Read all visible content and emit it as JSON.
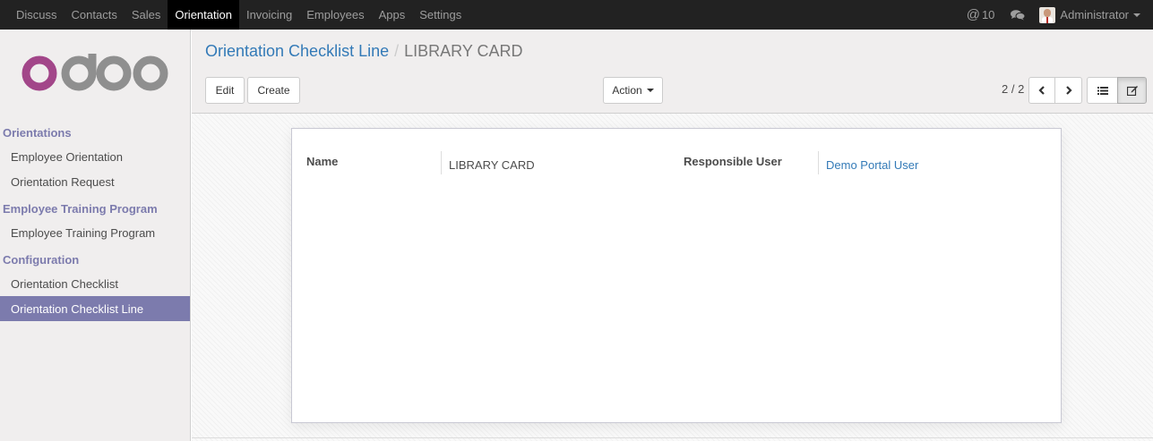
{
  "topbar": {
    "menu": [
      {
        "label": "Discuss",
        "active": false
      },
      {
        "label": "Contacts",
        "active": false
      },
      {
        "label": "Sales",
        "active": false
      },
      {
        "label": "Orientation",
        "active": true
      },
      {
        "label": "Invoicing",
        "active": false
      },
      {
        "label": "Employees",
        "active": false
      },
      {
        "label": "Apps",
        "active": false
      },
      {
        "label": "Settings",
        "active": false
      }
    ],
    "mentions_symbol": "@",
    "mentions_count": "10",
    "chat_icon": "comments-icon",
    "user_name": "Administrator"
  },
  "sidebar": {
    "logo_icon": "odoo-logo",
    "sections": [
      {
        "title": "Orientations",
        "items": [
          {
            "label": "Employee Orientation",
            "active": false
          },
          {
            "label": "Orientation Request",
            "active": false
          }
        ]
      },
      {
        "title": "Employee Training Program",
        "items": [
          {
            "label": "Employee Training Program",
            "active": false
          }
        ]
      },
      {
        "title": "Configuration",
        "items": [
          {
            "label": "Orientation Checklist",
            "active": false
          },
          {
            "label": "Orientation Checklist Line",
            "active": true
          }
        ]
      }
    ]
  },
  "control": {
    "breadcrumb_parent": "Orientation Checklist Line",
    "breadcrumb_sep": "/",
    "breadcrumb_current": "LIBRARY CARD",
    "edit_label": "Edit",
    "create_label": "Create",
    "action_label": "Action",
    "pager": "2 / 2",
    "prev_icon": "chevron-left-icon",
    "next_icon": "chevron-right-icon",
    "list_view_icon": "list-icon",
    "form_view_icon": "edit-icon"
  },
  "form": {
    "name_label": "Name",
    "name_value": "LIBRARY CARD",
    "responsible_label": "Responsible User",
    "responsible_value": "Demo Portal User"
  },
  "colors": {
    "accent": "#7c7bad",
    "link": "#337ab7",
    "topbar": "#222222"
  }
}
